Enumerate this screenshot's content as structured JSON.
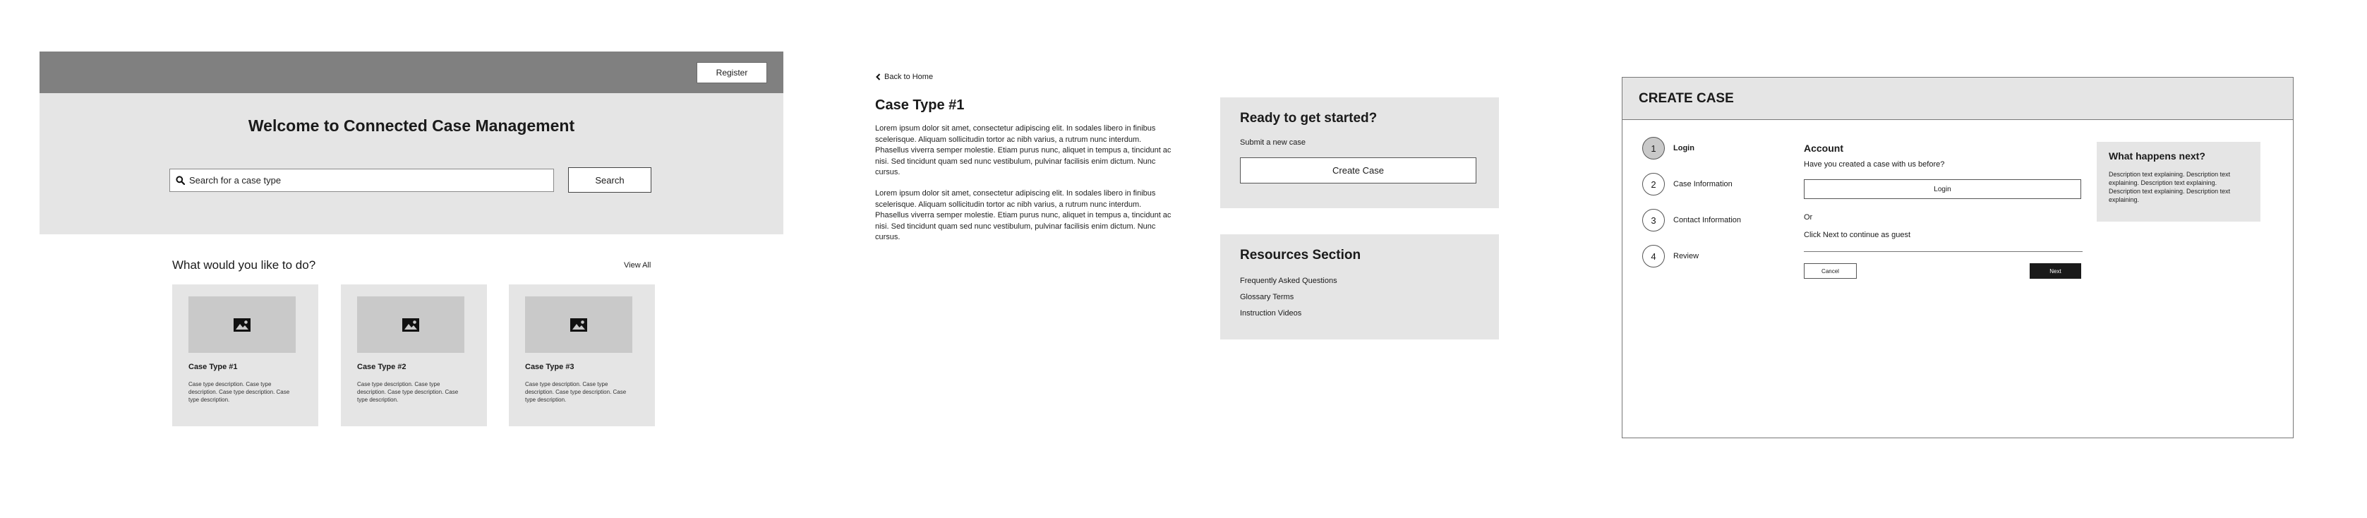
{
  "home": {
    "register_label": "Register",
    "title": "Welcome to Connected Case Management",
    "search": {
      "placeholder": "Search for a case type",
      "button_label": "Search"
    },
    "todo_title": "What would you like to do?",
    "view_all_label": "View All",
    "cards": [
      {
        "title": "Case Type #1",
        "description": "Case type description. Case type description. Case type description. Case type description."
      },
      {
        "title": "Case Type #2",
        "description": "Case type description. Case type description. Case type description. Case type description."
      },
      {
        "title": "Case Type #3",
        "description": "Case type description. Case type description. Case type description. Case type description."
      }
    ],
    "colors": {
      "header": "#808080",
      "hero": "#e5e5e5",
      "card": "#e5e5e5",
      "thumb": "#c9c9c9"
    }
  },
  "detail": {
    "back_label": "Back to Home",
    "title": "Case Type #1",
    "paragraphs": [
      "Lorem ipsum dolor sit amet, consectetur adipiscing elit. In sodales libero in finibus scelerisque. Aliquam sollicitudin tortor ac nibh varius, a rutrum nunc interdum. Phasellus viverra semper molestie. Etiam purus nunc, aliquet in tempus a, tincidunt ac nisi. Sed tincidunt quam sed nunc vestibulum, pulvinar facilisis enim dictum. Nunc cursus.",
      "Lorem ipsum dolor sit amet, consectetur adipiscing elit. In sodales libero in finibus scelerisque. Aliquam sollicitudin tortor ac nibh varius, a rutrum nunc interdum. Phasellus viverra semper molestie. Etiam purus nunc, aliquet in tempus a, tincidunt ac nisi. Sed tincidunt quam sed nunc vestibulum, pulvinar facilisis enim dictum. Nunc cursus."
    ],
    "ready": {
      "title": "Ready to get started?",
      "subtitle": "Submit a new case",
      "button_label": "Create Case"
    },
    "resources": {
      "title": "Resources Section",
      "links": [
        "Frequently Asked Questions",
        "Glossary Terms",
        "Instruction Videos"
      ]
    }
  },
  "create_case": {
    "title": "CREATE CASE",
    "steps": [
      {
        "number": "1",
        "label": "Login",
        "active": true
      },
      {
        "number": "2",
        "label": "Case Information",
        "active": false
      },
      {
        "number": "3",
        "label": "Contact Information",
        "active": false
      },
      {
        "number": "4",
        "label": "Review",
        "active": false
      }
    ],
    "account": {
      "title": "Account",
      "question": "Have you created a case with us before?",
      "login_label": "Login",
      "or_label": "Or",
      "guest_label": "Click Next to continue as guest",
      "cancel_label": "Cancel",
      "next_label": "Next"
    },
    "next_panel": {
      "title": "What happens next?",
      "description": "Description text explaining. Description text explaining. Description text explaining. Description text explaining. Description text explaining."
    }
  }
}
